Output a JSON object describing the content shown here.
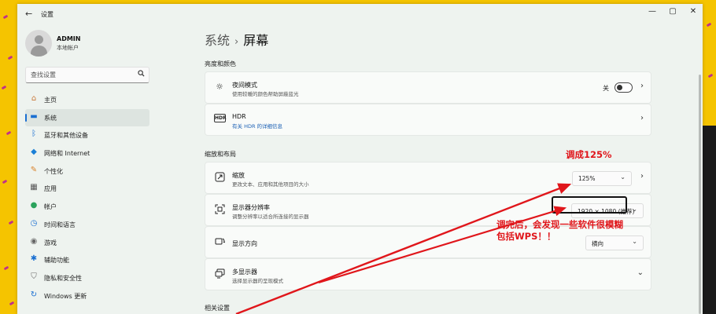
{
  "window": {
    "back_glyph": "←",
    "title": "设置",
    "controls": {
      "minimize": "—",
      "maximize": "▢",
      "close": "✕"
    }
  },
  "user": {
    "name": "ADMIN",
    "subtitle": "本地帐户"
  },
  "search": {
    "placeholder": "查找设置",
    "icon": "search-icon"
  },
  "nav": {
    "items": [
      {
        "label": "主页",
        "icon": "home-icon",
        "glyph": "⌂",
        "color": "#c9783a"
      },
      {
        "label": "系统",
        "icon": "system-display-icon",
        "glyph": "▬",
        "color": "#1a6fd1",
        "active": true
      },
      {
        "label": "蓝牙和其他设备",
        "icon": "bluetooth-icon",
        "glyph": "ᛒ",
        "color": "#1a6fd1"
      },
      {
        "label": "网络和 Internet",
        "icon": "wifi-icon",
        "glyph": "◆",
        "color": "#1a7fd6"
      },
      {
        "label": "个性化",
        "icon": "brush-icon",
        "glyph": "✎",
        "color": "#d9822b"
      },
      {
        "label": "应用",
        "icon": "apps-icon",
        "glyph": "▦",
        "color": "#555555"
      },
      {
        "label": "帐户",
        "icon": "account-icon",
        "glyph": "●",
        "color": "#2ba35c"
      },
      {
        "label": "时间和语言",
        "icon": "globe-clock-icon",
        "glyph": "◷",
        "color": "#1a6fd1"
      },
      {
        "label": "游戏",
        "icon": "gamepad-icon",
        "glyph": "◉",
        "color": "#666666"
      },
      {
        "label": "辅助功能",
        "icon": "accessibility-icon",
        "glyph": "✱",
        "color": "#1a6fd1"
      },
      {
        "label": "隐私和安全性",
        "icon": "shield-icon",
        "glyph": "⛉",
        "color": "#666666"
      },
      {
        "label": "Windows 更新",
        "icon": "windows-update-icon",
        "glyph": "↻",
        "color": "#1a6fd1"
      }
    ]
  },
  "breadcrumb": {
    "parent": "系统",
    "separator": "›",
    "current": "屏幕"
  },
  "sections": {
    "brightness_color": "亮度和颜色",
    "scale_layout": "缩放和布局",
    "related": "相关设置"
  },
  "cards": {
    "night_light": {
      "title": "夜间模式",
      "subtitle": "使用较暖的颜色帮助屏蔽蓝光",
      "toggle_label": "关",
      "icon": "sun-icon",
      "chevron": "›"
    },
    "hdr": {
      "title": "HDR",
      "subtitle": "有关 HDR 的详细信息",
      "icon": "hdr-icon",
      "icon_text": "HDR",
      "chevron": "›"
    },
    "scale": {
      "title": "缩放",
      "subtitle": "更改文本、应用和其他项目的大小",
      "value": "125%",
      "icon": "scale-icon",
      "chevron": "›"
    },
    "resolution": {
      "title": "显示器分辨率",
      "subtitle": "调整分辨率以适合所连接的显示器",
      "value": "1920 × 1080 (推荐)",
      "icon": "resolution-icon"
    },
    "orientation": {
      "title": "显示方向",
      "value": "横向",
      "icon": "orientation-icon"
    },
    "multi_display": {
      "title": "多显示器",
      "subtitle": "选择显示器的呈现模式",
      "icon": "multi-display-icon",
      "chevron": "⌄"
    }
  },
  "dropdown_chevron": "⌄",
  "annotations": {
    "scale_note": "调成125%",
    "blur_note_line1": "调完后，会发现一些软件很模糊",
    "blur_note_line2": "包括WPS！！",
    "color": "#e0161b"
  }
}
